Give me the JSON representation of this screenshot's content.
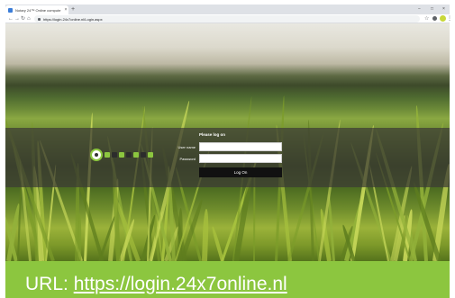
{
  "browser": {
    "tab_title": "Notary 24™ Online compute",
    "tab_close": "×",
    "new_tab": "+",
    "url": "https://login.24x7online.nl/Login.aspx",
    "window_controls": [
      "−",
      "□",
      "×"
    ]
  },
  "login": {
    "title": "Please log on",
    "username_label": "User name",
    "password_label": "Password",
    "username_value": "",
    "password_value": "",
    "login_button": "Log On"
  },
  "caption": {
    "prefix": "URL: ",
    "link": "https://login.24x7online.nl"
  },
  "colors": {
    "accent": "#8cc63f",
    "overlay": "#3c3a34",
    "button": "#111111"
  }
}
